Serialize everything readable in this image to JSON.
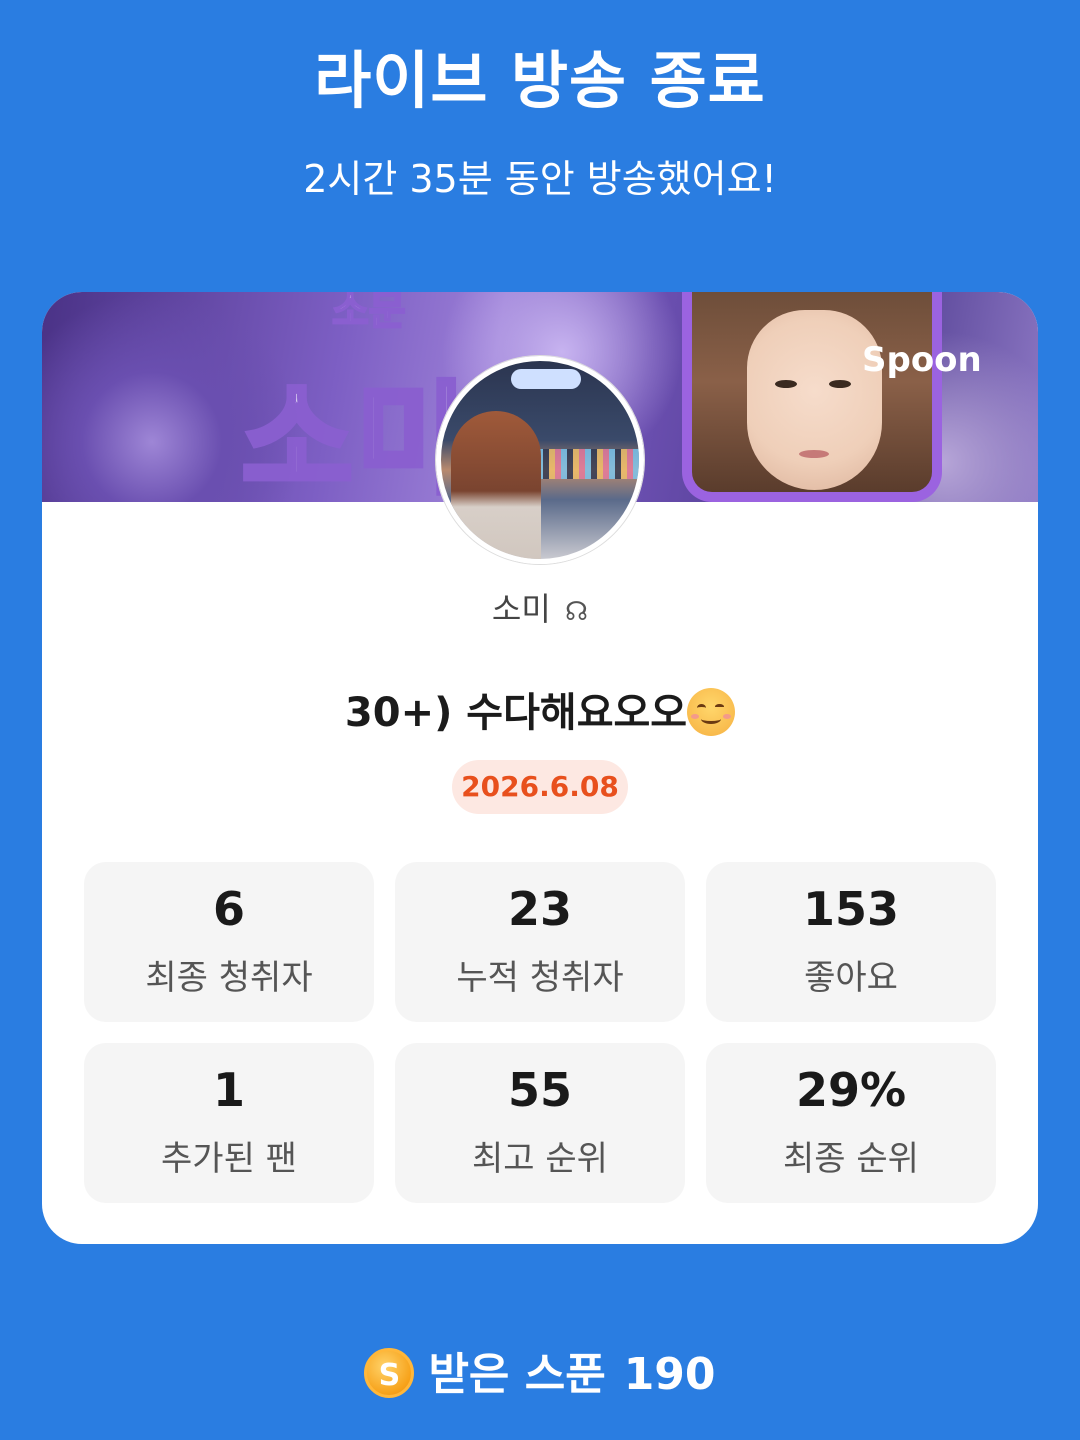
{
  "header": {
    "title": "라이브 방송 종료",
    "subtitle": "2시간 35분 동안 방송했어요!"
  },
  "banner": {
    "big_text": "소미",
    "small_text": "소문",
    "logo": "Spoon"
  },
  "profile": {
    "nickname": "소미",
    "nickname_icon": "headset-icon"
  },
  "live": {
    "title": "30+) 수다해요오오",
    "title_emoji": "smiling-face-icon",
    "date": "2026.6.08"
  },
  "stats": [
    {
      "value": "6",
      "label": "최종 청취자"
    },
    {
      "value": "23",
      "label": "누적 청취자"
    },
    {
      "value": "153",
      "label": "좋아요"
    },
    {
      "value": "1",
      "label": "추가된 팬"
    },
    {
      "value": "55",
      "label": "최고 순위"
    },
    {
      "value": "29%",
      "label": "최종 순위"
    }
  ],
  "footer": {
    "coin_letter": "S",
    "label": "받은 스푼",
    "value": "190"
  },
  "colors": {
    "background": "#2a7de1",
    "card": "#ffffff",
    "date_badge_bg": "#fde8e2",
    "date_badge_text": "#e8501d",
    "stat_bg": "#f5f5f5"
  }
}
